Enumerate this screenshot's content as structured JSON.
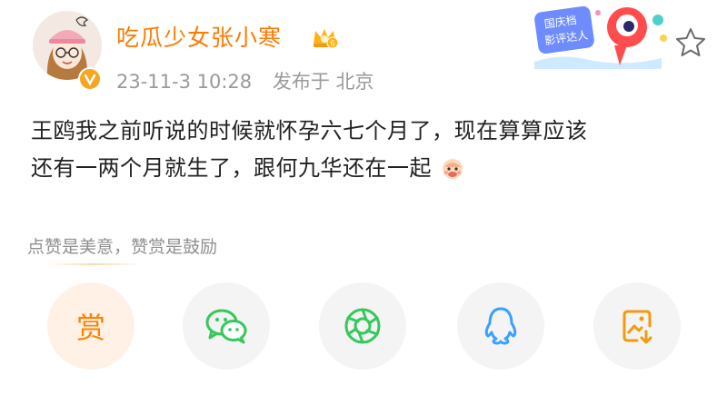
{
  "user": {
    "name": "吃瓜少女张小寒",
    "level_badge": "6"
  },
  "meta": {
    "time": "23-11-3 10:28",
    "location": "发布于 北京"
  },
  "promo": {
    "line1": "国庆档",
    "line2": "影评达人"
  },
  "post": {
    "text_line1": "王鸥我之前听说的时候就怀孕六七个月了，现在算算应该",
    "text_line2": "还有一两个月就生了，跟何九华还在一起"
  },
  "reward_tip": "点赞是美意，赞赏是鼓励",
  "share": {
    "reward_label": "赏"
  },
  "colors": {
    "accent": "#ff7a00",
    "muted": "#9a9a9a",
    "wechat_green": "#35c85a",
    "qq_blue": "#3aa0ff"
  }
}
